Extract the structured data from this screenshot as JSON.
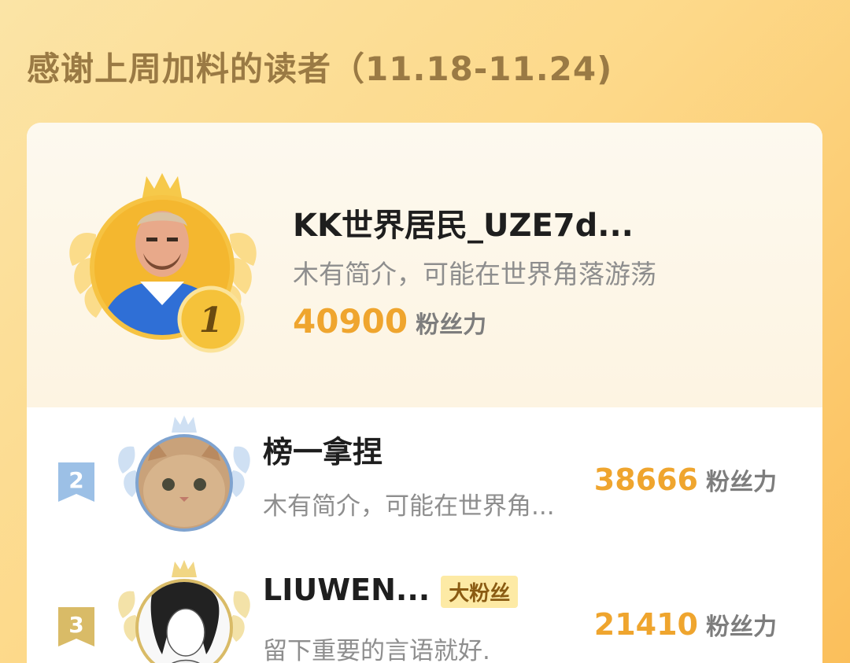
{
  "heading": "感谢上周加料的读者（11.18-11.24)",
  "leaderboard": [
    {
      "rank": "1",
      "name": "KK世界居民_UZE7d...",
      "bio": "木有简介，可能在世界角落游荡",
      "score": "40900",
      "unit": "粉丝力"
    },
    {
      "rank": "2",
      "name": "榜一拿捏",
      "bio": "木有简介，可能在世界角...",
      "score": "38666",
      "unit": "粉丝力"
    },
    {
      "rank": "3",
      "name": "LIUWEN...",
      "tag": "大粉丝",
      "bio": "留下重要的言语就好.",
      "score": "21410",
      "unit": "粉丝力"
    }
  ],
  "colors": {
    "gold": "#efa52e",
    "silver": "#8fb4dc",
    "bronze": "#d8b560",
    "tag_bg": "#fdeaa5"
  }
}
